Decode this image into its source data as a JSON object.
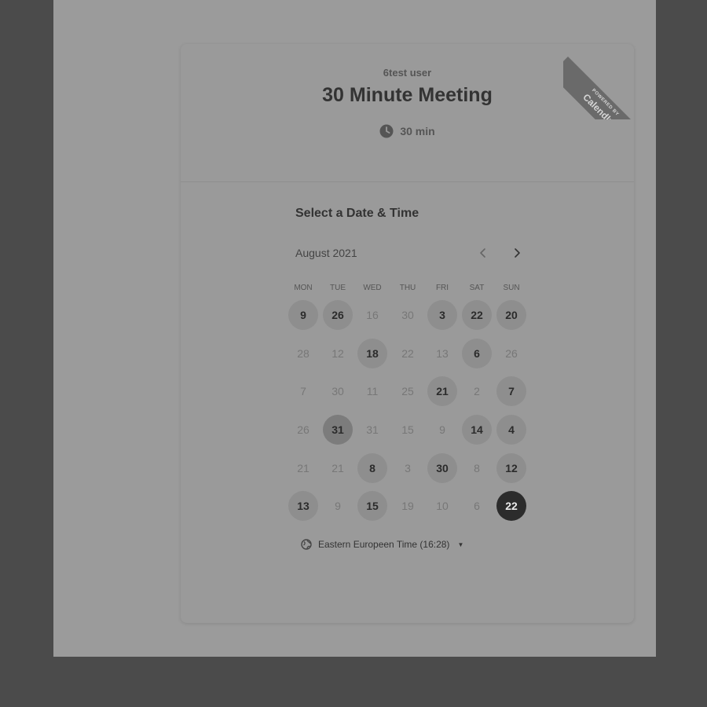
{
  "header": {
    "host": "6test user",
    "title": "30 Minute Meeting",
    "duration": "30 min",
    "ribbon_small": "POWERED BY",
    "ribbon_brand": "Calendly"
  },
  "calendar": {
    "section_title": "Select a Date & Time",
    "month": "August 2021",
    "weekdays": [
      "MON",
      "TUE",
      "WED",
      "THU",
      "FRI",
      "SAT",
      "SUN"
    ],
    "rows": [
      [
        {
          "d": "9",
          "a": true
        },
        {
          "d": "26",
          "a": true
        },
        {
          "d": "16",
          "a": false
        },
        {
          "d": "30",
          "a": false
        },
        {
          "d": "3",
          "a": true
        },
        {
          "d": "22",
          "a": true
        },
        {
          "d": "20",
          "a": true
        }
      ],
      [
        {
          "d": "28",
          "a": false
        },
        {
          "d": "12",
          "a": false
        },
        {
          "d": "18",
          "a": true
        },
        {
          "d": "22",
          "a": false
        },
        {
          "d": "13",
          "a": false
        },
        {
          "d": "6",
          "a": true
        },
        {
          "d": "26",
          "a": false
        }
      ],
      [
        {
          "d": "7",
          "a": false
        },
        {
          "d": "30",
          "a": false
        },
        {
          "d": "11",
          "a": false
        },
        {
          "d": "25",
          "a": false
        },
        {
          "d": "21",
          "a": true
        },
        {
          "d": "2",
          "a": false
        },
        {
          "d": "7",
          "a": true
        }
      ],
      [
        {
          "d": "26",
          "a": false
        },
        {
          "d": "31",
          "a": true,
          "dark": true
        },
        {
          "d": "31",
          "a": false
        },
        {
          "d": "15",
          "a": false
        },
        {
          "d": "9",
          "a": false
        },
        {
          "d": "14",
          "a": true
        },
        {
          "d": "4",
          "a": true
        }
      ],
      [
        {
          "d": "21",
          "a": false
        },
        {
          "d": "21",
          "a": false
        },
        {
          "d": "8",
          "a": true
        },
        {
          "d": "3",
          "a": false
        },
        {
          "d": "30",
          "a": true
        },
        {
          "d": "8",
          "a": false
        },
        {
          "d": "12",
          "a": true
        }
      ],
      [
        {
          "d": "13",
          "a": true
        },
        {
          "d": "9",
          "a": false
        },
        {
          "d": "15",
          "a": true
        },
        {
          "d": "19",
          "a": false
        },
        {
          "d": "10",
          "a": false
        },
        {
          "d": "6",
          "a": false
        },
        {
          "d": "22",
          "a": true,
          "selected": true
        }
      ]
    ]
  },
  "timezone": {
    "label": "Eastern Europeen Time (16:28)"
  },
  "colors": {
    "backdrop": "#4b4b4b",
    "selected_day": "#2c2c2c",
    "available_day": "#8e8e8e"
  }
}
